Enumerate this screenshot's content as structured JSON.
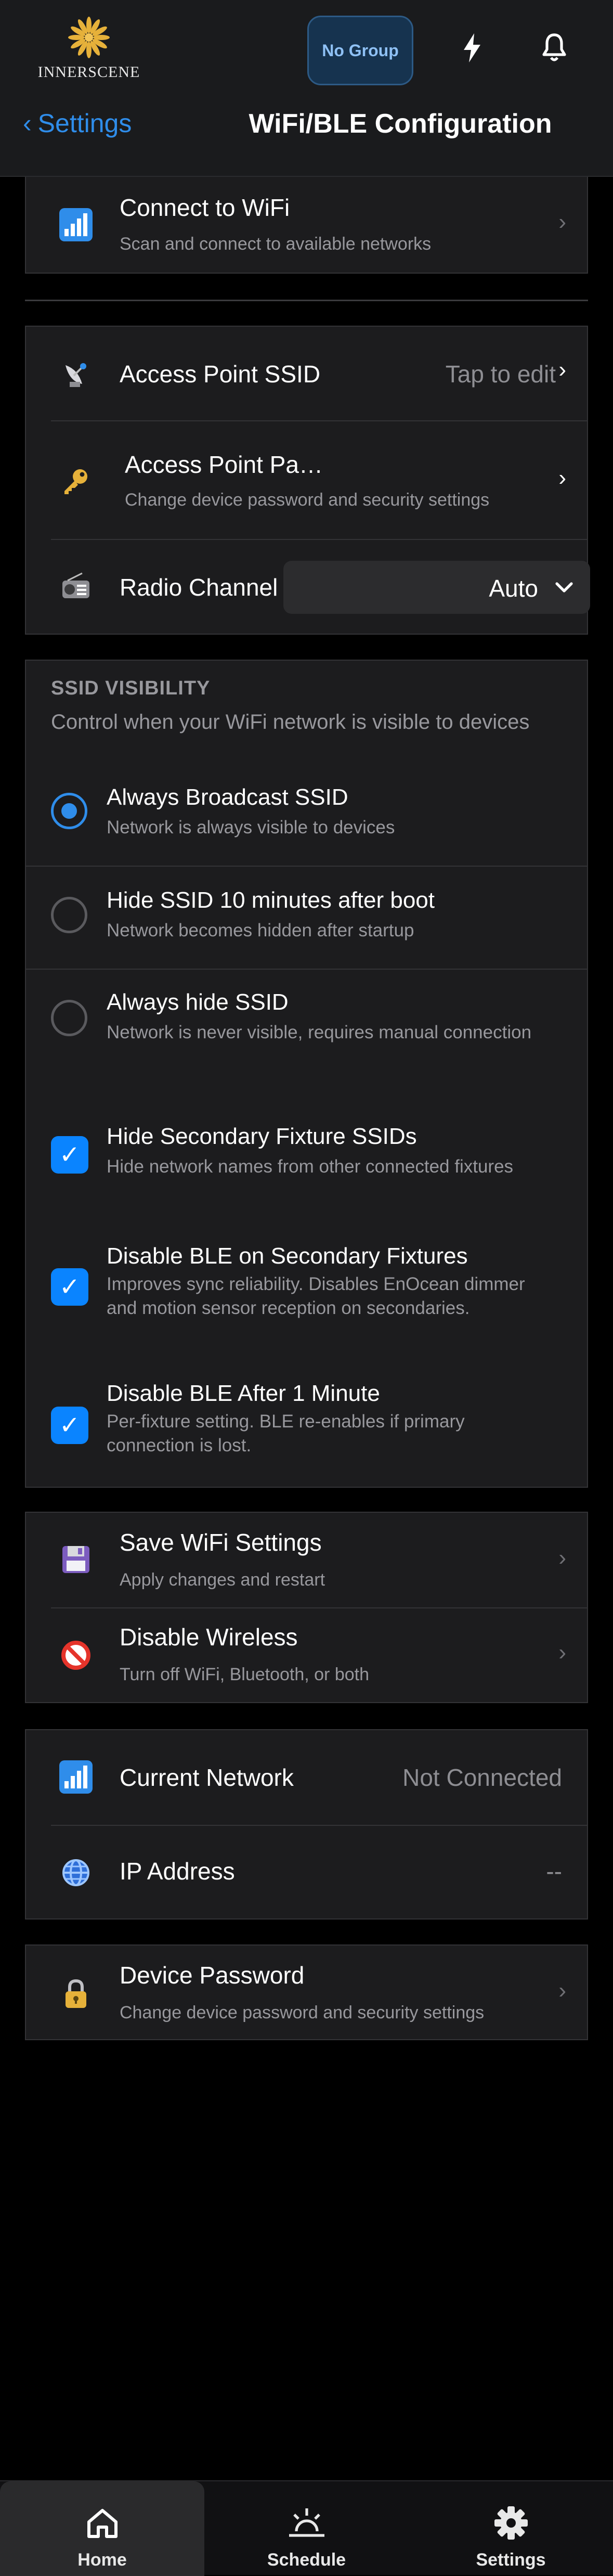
{
  "header": {
    "brand": "INNERSCENE",
    "group_button": "No Group",
    "back_label": "Settings",
    "title": "WiFi/BLE Configuration"
  },
  "connect": {
    "title": "Connect to WiFi",
    "subtitle": "Scan and connect to available networks"
  },
  "access_point": {
    "ssid_label": "Access Point SSID",
    "ssid_value": "Tap to edit",
    "password_label": "Access Point Pa…",
    "password_sub": "Change device password and security settings",
    "channel_label": "Radio Channel",
    "channel_value": "Auto"
  },
  "visibility": {
    "header": "SSID VISIBILITY",
    "description": "Control when your WiFi network is visible to devices",
    "options": [
      {
        "title": "Always Broadcast SSID",
        "subtitle": "Network is always visible to devices",
        "selected": true
      },
      {
        "title": "Hide SSID 10 minutes after boot",
        "subtitle": "Network becomes hidden after startup",
        "selected": false
      },
      {
        "title": "Always hide SSID",
        "subtitle": "Network is never visible, requires manual connection",
        "selected": false
      }
    ],
    "checkboxes": [
      {
        "title": "Hide Secondary Fixture SSIDs",
        "line1": "Hide network names from other connected fixtures",
        "line2": "",
        "checked": true
      },
      {
        "title": "Disable BLE on Secondary Fixtures",
        "line1": "Improves sync reliability. Disables EnOcean dimmer",
        "line2": "and motion sensor reception on secondaries.",
        "checked": true
      },
      {
        "title": "Disable BLE After 1 Minute",
        "line1": "Per-fixture setting. BLE re-enables if primary",
        "line2": "connection is lost.",
        "checked": true
      }
    ],
    "check_mark": "✓"
  },
  "actions": {
    "save_title": "Save WiFi Settings",
    "save_sub": "Apply changes and restart",
    "disable_title": "Disable Wireless",
    "disable_sub": "Turn off WiFi, Bluetooth, or both"
  },
  "status": {
    "network_label": "Current Network",
    "network_value": "Not Connected",
    "ip_label": "IP Address",
    "ip_value": "--"
  },
  "device_password": {
    "title": "Device Password",
    "subtitle": "Change device password and security settings"
  },
  "chevron": "›",
  "tabs": [
    {
      "label": "Home",
      "active": true
    },
    {
      "label": "Schedule",
      "active": false
    },
    {
      "label": "Settings",
      "active": false
    }
  ],
  "colors": {
    "accent": "#0a84ff",
    "card": "#1c1c1e",
    "background": "#000000"
  }
}
